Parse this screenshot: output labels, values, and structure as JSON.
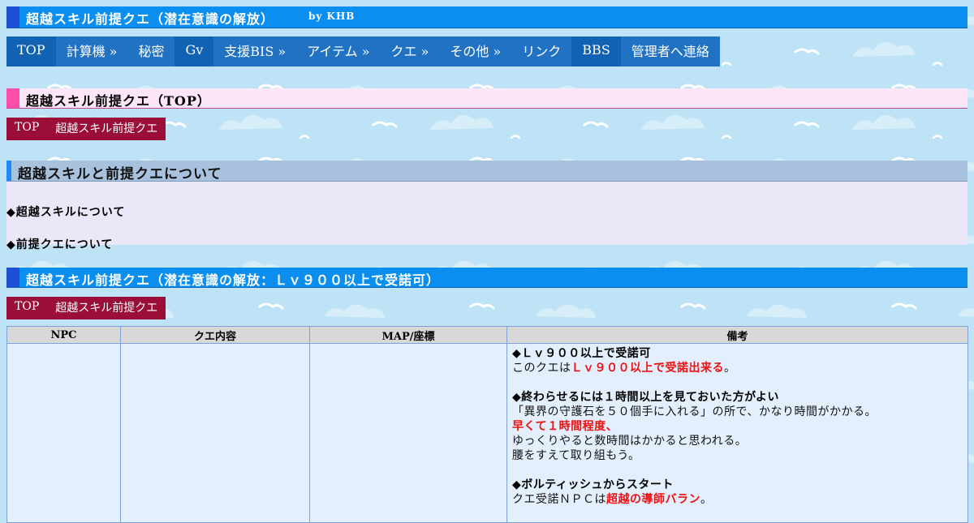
{
  "header": {
    "title": "超越スキル前提クエ（潜在意識の解放）",
    "by": "by KHB"
  },
  "nav": [
    {
      "label": "TOP",
      "style": "dark"
    },
    {
      "label": "計算機 »",
      "style": "light"
    },
    {
      "label": "秘密",
      "style": "light"
    },
    {
      "label": "Gv",
      "style": "dark"
    },
    {
      "label": "支援BIS »",
      "style": "light"
    },
    {
      "label": "アイテム »",
      "style": "light"
    },
    {
      "label": "クエ »",
      "style": "light"
    },
    {
      "label": "その他 »",
      "style": "light"
    },
    {
      "label": "リンク",
      "style": "light"
    },
    {
      "label": "BBS",
      "style": "dark"
    },
    {
      "label": "管理者へ連絡",
      "style": "light"
    }
  ],
  "section_top": {
    "title": "超越スキル前提クエ（TOP）"
  },
  "breadcrumb1": {
    "top": "TOP",
    "current": "超越スキル前提クエ"
  },
  "about": {
    "title": "超越スキルと前提クエについて",
    "line1": "◆超越スキルについて",
    "line2": "◆前提クエについて"
  },
  "quest": {
    "title": "超越スキル前提クエ（潜在意識の解放：Ｌｖ９００以上で受諾可）"
  },
  "breadcrumb2": {
    "top": "TOP",
    "current": "超越スキル前提クエ"
  },
  "table": {
    "headers": {
      "npc": "NPC",
      "content": "クエ内容",
      "map": "MAP/座標",
      "notes": "備考"
    },
    "notes": {
      "h1": "◆Ｌｖ９００以上で受諾可",
      "p1a": "このクエは",
      "p1r": "Ｌｖ９００以上で受諾出来る",
      "p1b": "。",
      "h2": "◆終わらせるには１時間以上を見ておいた方がよい",
      "p2": "「異界の守護石を５０個手に入れる」の所で、かなり時間がかかる。",
      "p3r": "早くて１時間程度",
      "p3b": "、",
      "p4": "ゆっくりやると数時間はかかると思われる。",
      "p5": "腰をすえて取り組もう。",
      "h3": "◆ボルティッシュからスタート",
      "p6a": "クエ受諾ＮＰＣは",
      "p6r": "超越の導師バラン",
      "p6b": "。"
    }
  },
  "colors": {
    "title_bar": "#0a8ef0",
    "nav": "#2272c4",
    "section_pink": "#fde6f7",
    "breadcrumb": "#9b0e37",
    "highlight_red": "#ee1111"
  }
}
